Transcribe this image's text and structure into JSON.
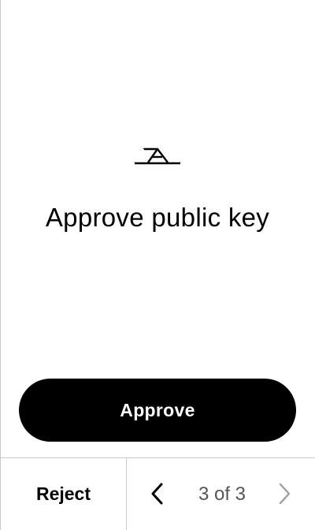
{
  "screen": {
    "title": "Approve public key",
    "logo_icon": "trezor-brand-icon"
  },
  "actions": {
    "approve_label": "Approve",
    "reject_label": "Reject"
  },
  "pager": {
    "current": 3,
    "total": 3,
    "indicator_text": "3 of 3",
    "prev_icon": "chevron-left-icon",
    "next_icon": "chevron-right-icon",
    "next_enabled": false
  },
  "colors": {
    "primary": "#000000",
    "background": "#ffffff",
    "divider": "#c8c8c8",
    "disabled": "#a0a0a0"
  }
}
